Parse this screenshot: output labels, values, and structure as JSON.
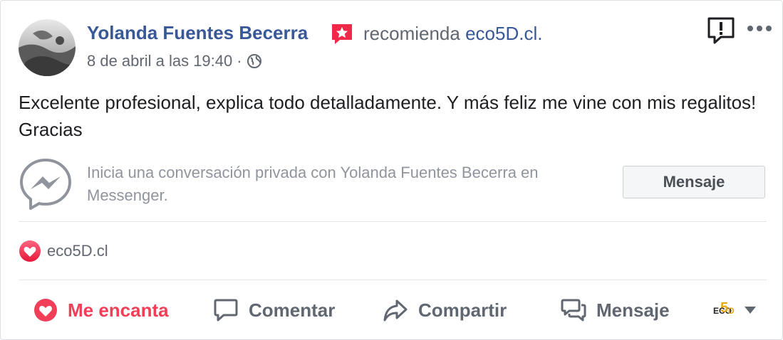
{
  "post": {
    "author": "Yolanda Fuentes Becerra",
    "action_text": "recomienda",
    "page_name": "eco5D.cl.",
    "timestamp": "8 de abril a las 19:40",
    "separator": "·",
    "privacy_icon": "globe-icon",
    "text": "Excelente profesional, explica todo detalladamente. Y más feliz me vine con mis regalitos! Gracias"
  },
  "messenger": {
    "icon": "messenger-icon",
    "prompt": "Inicia una conversación privada con Yolanda Fuentes Becerra en Messenger.",
    "button_label": "Mensaje"
  },
  "reactions": {
    "icon": "love-reaction-icon",
    "label": "eco5D.cl"
  },
  "actions": [
    {
      "label": "Me encanta",
      "icon": "heart-icon",
      "color": "#f33e58"
    },
    {
      "label": "Comentar",
      "icon": "comment-icon"
    },
    {
      "label": "Compartir",
      "icon": "share-icon"
    },
    {
      "label": "Mensaje",
      "icon": "message-icon"
    }
  ],
  "page_selector": {
    "logo_parts": [
      "ECO",
      "5",
      "D"
    ]
  },
  "colors": {
    "link": "#385898",
    "muted": "#616770",
    "love": "#f33e58",
    "badge": "#f02849",
    "logo_gold": "#e6a91c"
  }
}
